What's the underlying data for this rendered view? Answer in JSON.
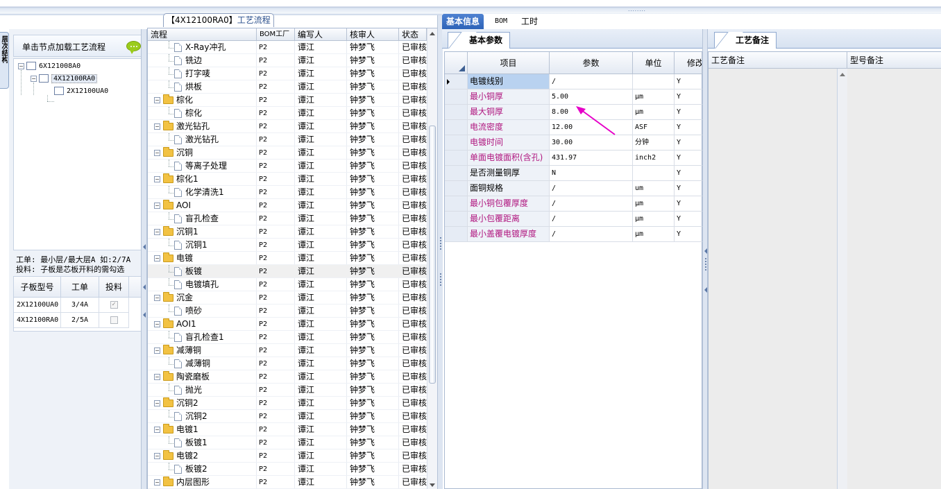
{
  "app": {
    "grip_glyph": "········",
    "side_tab_label": "层次结构"
  },
  "left": {
    "load_button_label": "单击节点加载工艺流程",
    "tree": {
      "root": "6X121008A0",
      "child": "4X12100RA0",
      "grandchild": "2X12100UA0"
    },
    "info_line1": "工单: 最小层/最大层A 如:2/7A",
    "info_line2": "投料: 子板是芯板开料的需勾选",
    "subgrid": {
      "headers": [
        "子板型号",
        "工单",
        "投料"
      ],
      "rows": [
        {
          "model": "2X12100UA0",
          "order": "3/4A",
          "checked": true
        },
        {
          "model": "4X12100RA0",
          "order": "2/5A",
          "checked": false
        }
      ]
    }
  },
  "mid": {
    "tab_prefix": "【4X12100RA0】",
    "tab_suffix": "工艺流程",
    "headers": [
      "流程",
      "BOM工厂",
      "编写人",
      "核审人",
      "状态"
    ],
    "rows": [
      {
        "level": 2,
        "kind": "doc",
        "name": "X-Ray冲孔",
        "bom": "P2",
        "writer": "谭江",
        "reviewer": "钟梦飞",
        "status": "已审核"
      },
      {
        "level": 2,
        "kind": "doc",
        "name": "铣边",
        "bom": "P2",
        "writer": "谭江",
        "reviewer": "钟梦飞",
        "status": "已审核"
      },
      {
        "level": 2,
        "kind": "doc",
        "name": "打字唛",
        "bom": "P2",
        "writer": "谭江",
        "reviewer": "钟梦飞",
        "status": "已审核"
      },
      {
        "level": 2,
        "kind": "doc",
        "name": "烘板",
        "bom": "P2",
        "writer": "谭江",
        "reviewer": "钟梦飞",
        "status": "已审核"
      },
      {
        "level": 1,
        "kind": "folder",
        "name": "棕化",
        "bom": "P2",
        "writer": "谭江",
        "reviewer": "钟梦飞",
        "status": "已审核"
      },
      {
        "level": 2,
        "kind": "doc",
        "name": "棕化",
        "bom": "P2",
        "writer": "谭江",
        "reviewer": "钟梦飞",
        "status": "已审核"
      },
      {
        "level": 1,
        "kind": "folder",
        "name": "激光钻孔",
        "bom": "P2",
        "writer": "谭江",
        "reviewer": "钟梦飞",
        "status": "已审核"
      },
      {
        "level": 2,
        "kind": "doc",
        "name": "激光钻孔",
        "bom": "P2",
        "writer": "谭江",
        "reviewer": "钟梦飞",
        "status": "已审核"
      },
      {
        "level": 1,
        "kind": "folder",
        "name": "沉铜",
        "bom": "P2",
        "writer": "谭江",
        "reviewer": "钟梦飞",
        "status": "已审核"
      },
      {
        "level": 2,
        "kind": "doc",
        "name": "等离子处理",
        "bom": "P2",
        "writer": "谭江",
        "reviewer": "钟梦飞",
        "status": "已审核"
      },
      {
        "level": 1,
        "kind": "folder",
        "name": "棕化1",
        "bom": "P2",
        "writer": "谭江",
        "reviewer": "钟梦飞",
        "status": "已审核"
      },
      {
        "level": 2,
        "kind": "doc",
        "name": "化学清洗1",
        "bom": "P2",
        "writer": "谭江",
        "reviewer": "钟梦飞",
        "status": "已审核"
      },
      {
        "level": 1,
        "kind": "folder",
        "name": "AOI",
        "bom": "P2",
        "writer": "谭江",
        "reviewer": "钟梦飞",
        "status": "已审核"
      },
      {
        "level": 2,
        "kind": "doc",
        "name": "盲孔检查",
        "bom": "P2",
        "writer": "谭江",
        "reviewer": "钟梦飞",
        "status": "已审核"
      },
      {
        "level": 1,
        "kind": "folder",
        "name": "沉铜1",
        "bom": "P2",
        "writer": "谭江",
        "reviewer": "钟梦飞",
        "status": "已审核"
      },
      {
        "level": 2,
        "kind": "doc",
        "name": "沉铜1",
        "bom": "P2",
        "writer": "谭江",
        "reviewer": "钟梦飞",
        "status": "已审核"
      },
      {
        "level": 1,
        "kind": "folder",
        "name": "电镀",
        "bom": "P2",
        "writer": "谭江",
        "reviewer": "钟梦飞",
        "status": "已审核"
      },
      {
        "level": 2,
        "kind": "doc",
        "name": "板镀",
        "bom": "P2",
        "writer": "谭江",
        "reviewer": "钟梦飞",
        "status": "已审核",
        "highlight": true
      },
      {
        "level": 2,
        "kind": "doc",
        "name": "电镀填孔",
        "bom": "P2",
        "writer": "谭江",
        "reviewer": "钟梦飞",
        "status": "已审核"
      },
      {
        "level": 1,
        "kind": "folder",
        "name": "沉金",
        "bom": "P2",
        "writer": "谭江",
        "reviewer": "钟梦飞",
        "status": "已审核"
      },
      {
        "level": 2,
        "kind": "doc",
        "name": "喷砂",
        "bom": "P2",
        "writer": "谭江",
        "reviewer": "钟梦飞",
        "status": "已审核"
      },
      {
        "level": 1,
        "kind": "folder",
        "name": "AOI1",
        "bom": "P2",
        "writer": "谭江",
        "reviewer": "钟梦飞",
        "status": "已审核"
      },
      {
        "level": 2,
        "kind": "doc",
        "name": "盲孔检查1",
        "bom": "P2",
        "writer": "谭江",
        "reviewer": "钟梦飞",
        "status": "已审核"
      },
      {
        "level": 1,
        "kind": "folder",
        "name": "减薄铜",
        "bom": "P2",
        "writer": "谭江",
        "reviewer": "钟梦飞",
        "status": "已审核"
      },
      {
        "level": 2,
        "kind": "doc",
        "name": "减薄铜",
        "bom": "P2",
        "writer": "谭江",
        "reviewer": "钟梦飞",
        "status": "已审核"
      },
      {
        "level": 1,
        "kind": "folder",
        "name": "陶瓷磨板",
        "bom": "P2",
        "writer": "谭江",
        "reviewer": "钟梦飞",
        "status": "已审核"
      },
      {
        "level": 2,
        "kind": "doc",
        "name": "抛光",
        "bom": "P2",
        "writer": "谭江",
        "reviewer": "钟梦飞",
        "status": "已审核"
      },
      {
        "level": 1,
        "kind": "folder",
        "name": "沉铜2",
        "bom": "P2",
        "writer": "谭江",
        "reviewer": "钟梦飞",
        "status": "已审核"
      },
      {
        "level": 2,
        "kind": "doc",
        "name": "沉铜2",
        "bom": "P2",
        "writer": "谭江",
        "reviewer": "钟梦飞",
        "status": "已审核"
      },
      {
        "level": 1,
        "kind": "folder",
        "name": "电镀1",
        "bom": "P2",
        "writer": "谭江",
        "reviewer": "钟梦飞",
        "status": "已审核"
      },
      {
        "level": 2,
        "kind": "doc",
        "name": "板镀1",
        "bom": "P2",
        "writer": "谭江",
        "reviewer": "钟梦飞",
        "status": "已审核"
      },
      {
        "level": 1,
        "kind": "folder",
        "name": "电镀2",
        "bom": "P2",
        "writer": "谭江",
        "reviewer": "钟梦飞",
        "status": "已审核"
      },
      {
        "level": 2,
        "kind": "doc",
        "name": "板镀2",
        "bom": "P2",
        "writer": "谭江",
        "reviewer": "钟梦飞",
        "status": "已审核"
      },
      {
        "level": 1,
        "kind": "folder",
        "name": "内层图形",
        "bom": "P2",
        "writer": "谭江",
        "reviewer": "钟梦飞",
        "status": "已审核"
      }
    ]
  },
  "right": {
    "tabs": [
      "基本信息",
      "BOM",
      "工时"
    ],
    "subtab": "基本参数",
    "grid_headers": [
      "项目",
      "参数",
      "单位",
      "修改"
    ],
    "params": [
      {
        "item": "电镀线别",
        "value": "/",
        "unit": "",
        "mod": "Y",
        "magenta": false
      },
      {
        "item": "最小铜厚",
        "value": "5.00",
        "unit": "μm",
        "mod": "Y",
        "magenta": true
      },
      {
        "item": "最大铜厚",
        "value": "8.00",
        "unit": "μm",
        "mod": "Y",
        "magenta": true
      },
      {
        "item": "电流密度",
        "value": "12.00",
        "unit": "ASF",
        "mod": "Y",
        "magenta": true
      },
      {
        "item": "电镀时间",
        "value": "30.00",
        "unit": "分钟",
        "mod": "Y",
        "magenta": true
      },
      {
        "item": "单面电镀面积(含孔)",
        "value": "431.97",
        "unit": "inch2",
        "mod": "Y",
        "magenta": true
      },
      {
        "item": "是否测量铜厚",
        "value": "N",
        "unit": "",
        "mod": "Y",
        "magenta": false
      },
      {
        "item": "面铜规格",
        "value": "/",
        "unit": "um",
        "mod": "Y",
        "magenta": false
      },
      {
        "item": "最小铜包覆厚度",
        "value": "/",
        "unit": "μm",
        "mod": "Y",
        "magenta": true
      },
      {
        "item": "最小包覆距离",
        "value": "/",
        "unit": "μm",
        "mod": "Y",
        "magenta": true
      },
      {
        "item": "最小盖覆电镀厚度",
        "value": "/",
        "unit": "μm",
        "mod": "Y",
        "magenta": true
      }
    ],
    "notes_tab": "工艺备注",
    "notes_headers": [
      "工艺备注",
      "型号备注"
    ]
  },
  "colors": {
    "magenta_label": "#b0177f",
    "annotation_arrow": "#e600c8",
    "active_tab": "#2d63b8"
  }
}
